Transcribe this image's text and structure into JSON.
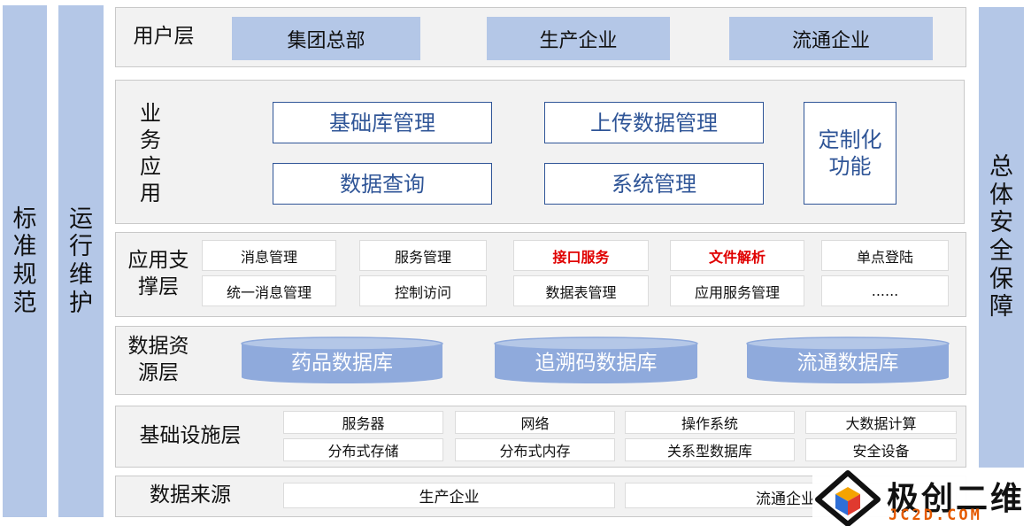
{
  "pillars": {
    "left1": "标准规范",
    "left2": "运行维护",
    "right": "总体安全保障"
  },
  "user_layer": {
    "label": "用户层",
    "items": [
      "集团总部",
      "生产企业",
      "流通企业"
    ]
  },
  "business_layer": {
    "label": "业务应用",
    "items": [
      "基础库管理",
      "上传数据管理",
      "数据查询",
      "系统管理",
      "定制化功能"
    ]
  },
  "support_layer": {
    "label": "应用支撑层",
    "rows": [
      [
        "消息管理",
        "服务管理",
        "接口服务",
        "文件解析",
        "单点登陆"
      ],
      [
        "统一消息管理",
        "控制访问",
        "数据表管理",
        "应用服务管理",
        "......"
      ]
    ]
  },
  "data_layer": {
    "label": "数据资源层",
    "databases": [
      "药品数据库",
      "追溯码数据库",
      "流通数据库"
    ]
  },
  "infra_layer": {
    "label": "基础设施层",
    "rows": [
      [
        "服务器",
        "网络",
        "操作系统",
        "大数据计算"
      ],
      [
        "分布式存储",
        "分布式内存",
        "关系型数据库",
        "安全设备"
      ]
    ]
  },
  "source_layer": {
    "label": "数据来源",
    "items": [
      "生产企业",
      "流通企业"
    ]
  },
  "colors": {
    "pillar": "#b4c7e7",
    "accent_blue": "#2f5597",
    "highlight_red": "#e00000",
    "db_fill": "#8faadc"
  },
  "watermark": {
    "name": "极创二维",
    "domain": "JC2D.COM"
  }
}
